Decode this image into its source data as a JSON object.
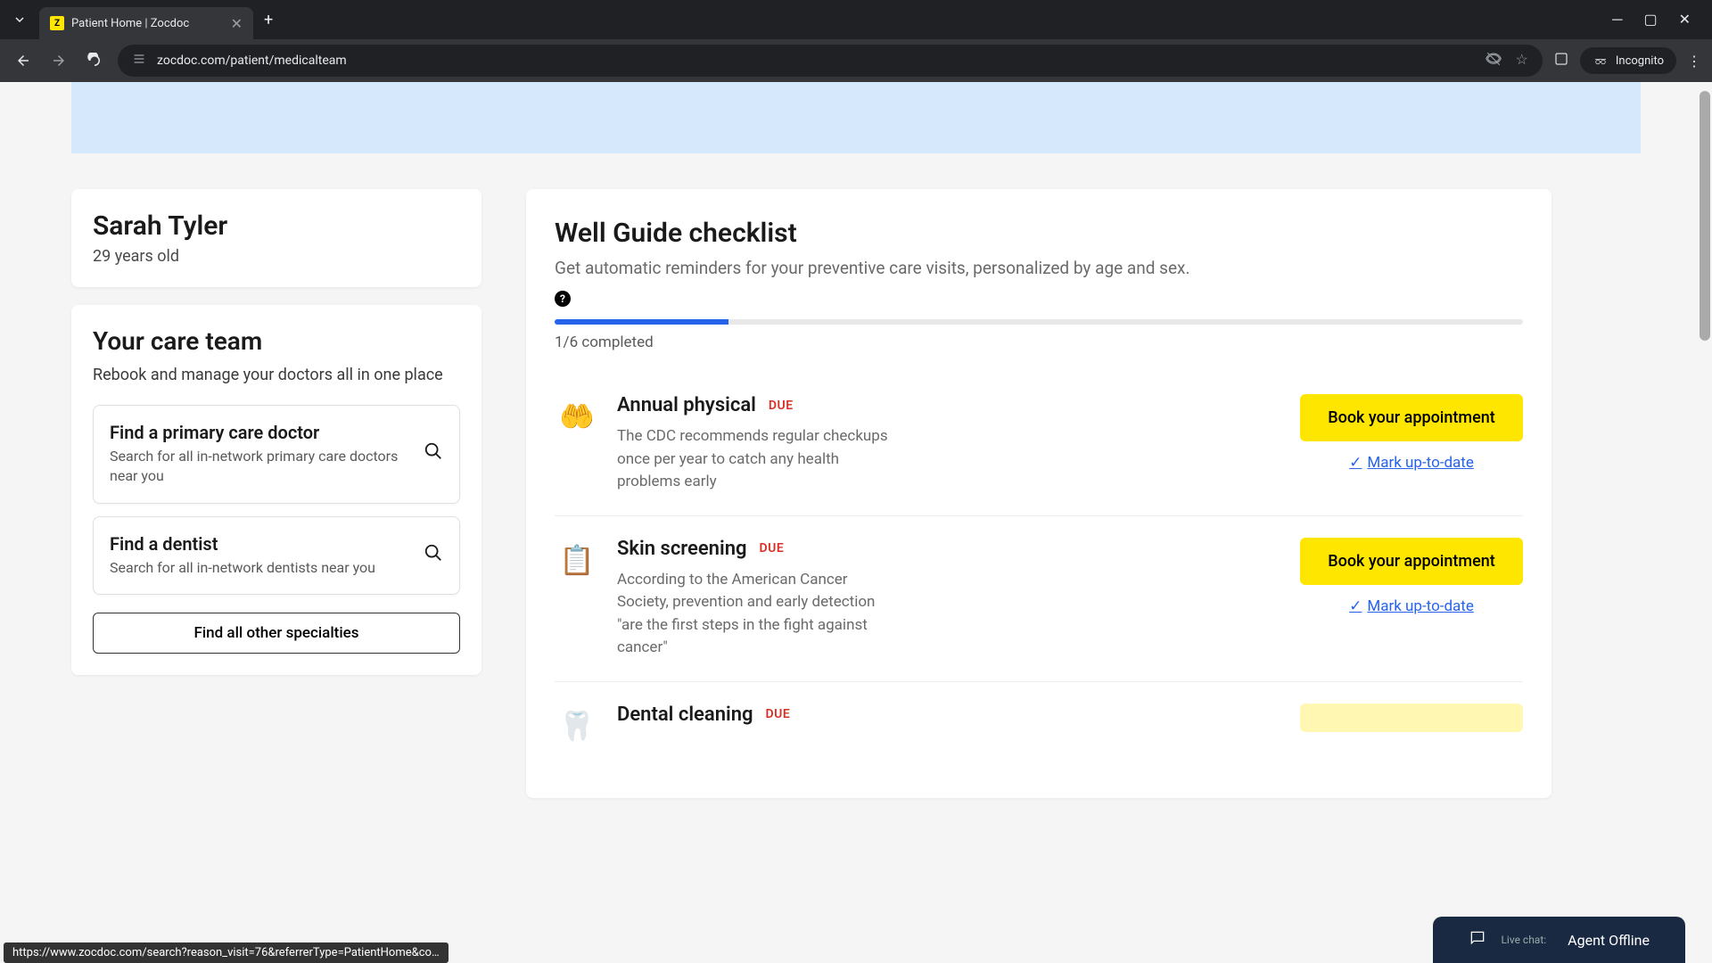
{
  "browser": {
    "tab_title": "Patient Home | Zocdoc",
    "url": "zocdoc.com/patient/medicalteam",
    "incognito_label": "Incognito",
    "status_url": "https://www.zocdoc.com/search?reason_visit=76&referrerType=PatientHome&co…"
  },
  "profile": {
    "name": "Sarah Tyler",
    "age": "29 years old"
  },
  "care_team": {
    "title": "Your care team",
    "subtitle": "Rebook and manage your doctors all in one place",
    "find_cards": [
      {
        "title": "Find a primary care doctor",
        "desc": "Search for all in-network primary care doctors near you"
      },
      {
        "title": "Find a dentist",
        "desc": "Search for all in-network dentists near you"
      }
    ],
    "find_all_label": "Find all other specialties"
  },
  "well_guide": {
    "title": "Well Guide checklist",
    "desc": "Get automatic reminders for your preventive care visits, personalized by age and sex.",
    "progress_text": "1/6 completed",
    "book_label": "Book your appointment",
    "mark_label": "Mark up-to-date",
    "items": [
      {
        "title": "Annual physical",
        "badge": "DUE",
        "desc": "The CDC recommends regular checkups once per year to catch any health problems early",
        "icon": "🤲"
      },
      {
        "title": "Skin screening",
        "badge": "DUE",
        "desc": "According to the American Cancer Society, prevention and early detection \"are the first steps in the fight against cancer\"",
        "icon": "📋"
      },
      {
        "title": "Dental cleaning",
        "badge": "DUE",
        "desc": "",
        "icon": "🦷"
      }
    ]
  },
  "chat": {
    "prefix": "Live chat:",
    "status": "Agent Offline"
  }
}
